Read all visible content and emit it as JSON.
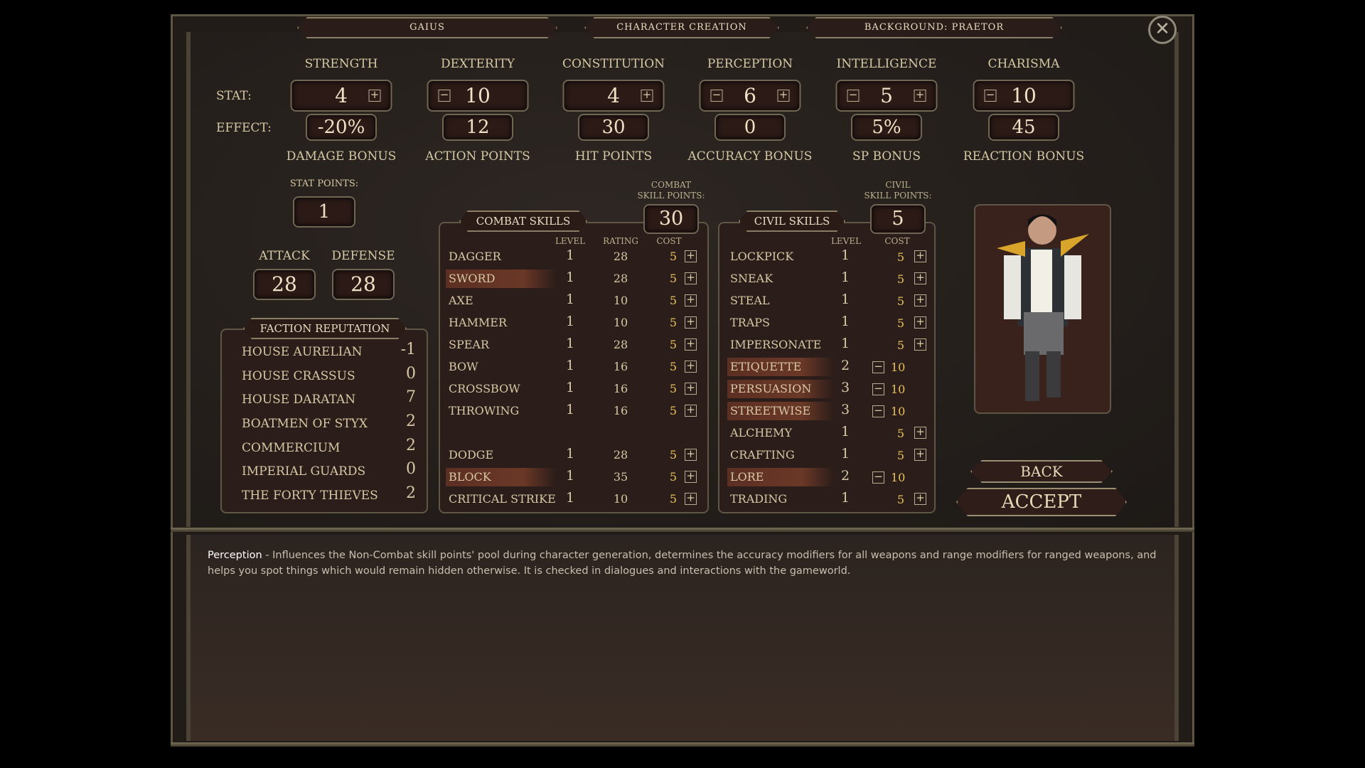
{
  "header": {
    "tabs": [
      "GAIUS",
      "CHARACTER CREATION",
      "BACKGROUND: PRAETOR"
    ],
    "close_icon": "close-x-icon"
  },
  "labels": {
    "stat": "STAT:",
    "effect": "EFFECT:",
    "stat_points": "STAT POINTS:",
    "attack": "ATTACK",
    "defense": "DEFENSE",
    "combat_points_l1": "COMBAT",
    "combat_points_l2": "SKILL POINTS:",
    "civil_points_l1": "CIVIL",
    "civil_points_l2": "SKILL POINTS:"
  },
  "stats": [
    {
      "name": "STRENGTH",
      "value": "4",
      "minus": false,
      "plus": true,
      "effect": "-20%",
      "bonus": "DAMAGE BONUS"
    },
    {
      "name": "DEXTERITY",
      "value": "10",
      "minus": true,
      "plus": false,
      "effect": "12",
      "bonus": "ACTION POINTS"
    },
    {
      "name": "CONSTITUTION",
      "value": "4",
      "minus": false,
      "plus": true,
      "effect": "30",
      "bonus": "HIT POINTS"
    },
    {
      "name": "PERCEPTION",
      "value": "6",
      "minus": true,
      "plus": true,
      "effect": "0",
      "bonus": "ACCURACY BONUS"
    },
    {
      "name": "INTELLIGENCE",
      "value": "5",
      "minus": true,
      "plus": true,
      "effect": "5%",
      "bonus": "SP BONUS"
    },
    {
      "name": "CHARISMA",
      "value": "10",
      "minus": true,
      "plus": false,
      "effect": "45",
      "bonus": "REACTION BONUS"
    }
  ],
  "stat_points": "1",
  "attack": "28",
  "defense": "28",
  "faction": {
    "title": "FACTION REPUTATION",
    "items": [
      {
        "name": "HOUSE AURELIAN",
        "value": "-1"
      },
      {
        "name": "HOUSE CRASSUS",
        "value": "0"
      },
      {
        "name": "HOUSE DARATAN",
        "value": "7"
      },
      {
        "name": "BOATMEN OF STYX",
        "value": "2"
      },
      {
        "name": "COMMERCIUM",
        "value": "2"
      },
      {
        "name": "IMPERIAL GUARDS",
        "value": "0"
      },
      {
        "name": "THE FORTY THIEVES",
        "value": "2"
      }
    ]
  },
  "combat": {
    "title": "COMBAT SKILLS",
    "points": "30",
    "headers": {
      "level": "LEVEL",
      "rating": "RATING",
      "cost": "COST"
    },
    "items": [
      {
        "name": "DAGGER",
        "level": "1",
        "rating": "28",
        "cost": "5",
        "hl": false
      },
      {
        "name": "SWORD",
        "level": "1",
        "rating": "28",
        "cost": "5",
        "hl": true
      },
      {
        "name": "AXE",
        "level": "1",
        "rating": "10",
        "cost": "5",
        "hl": false
      },
      {
        "name": "HAMMER",
        "level": "1",
        "rating": "10",
        "cost": "5",
        "hl": false
      },
      {
        "name": "SPEAR",
        "level": "1",
        "rating": "28",
        "cost": "5",
        "hl": false
      },
      {
        "name": "BOW",
        "level": "1",
        "rating": "16",
        "cost": "5",
        "hl": false
      },
      {
        "name": "CROSSBOW",
        "level": "1",
        "rating": "16",
        "cost": "5",
        "hl": false
      },
      {
        "name": "THROWING",
        "level": "1",
        "rating": "16",
        "cost": "5",
        "hl": false
      },
      {
        "name": "DODGE",
        "level": "1",
        "rating": "28",
        "cost": "5",
        "hl": false
      },
      {
        "name": "BLOCK",
        "level": "1",
        "rating": "35",
        "cost": "5",
        "hl": true
      },
      {
        "name": "CRITICAL STRIKE",
        "level": "1",
        "rating": "10",
        "cost": "5",
        "hl": false
      }
    ]
  },
  "civil": {
    "title": "CIVIL SKILLS",
    "points": "5",
    "headers": {
      "level": "LEVEL",
      "cost": "COST"
    },
    "items": [
      {
        "name": "LOCKPICK",
        "level": "1",
        "cost": "5",
        "hl": false
      },
      {
        "name": "SNEAK",
        "level": "1",
        "cost": "5",
        "hl": false
      },
      {
        "name": "STEAL",
        "level": "1",
        "cost": "5",
        "hl": false
      },
      {
        "name": "TRAPS",
        "level": "1",
        "cost": "5",
        "hl": false
      },
      {
        "name": "IMPERSONATE",
        "level": "1",
        "cost": "5",
        "hl": false
      },
      {
        "name": "ETIQUETTE",
        "level": "2",
        "cost": "10",
        "hl": true
      },
      {
        "name": "PERSUASION",
        "level": "3",
        "cost": "10",
        "hl": true
      },
      {
        "name": "STREETWISE",
        "level": "3",
        "cost": "10",
        "hl": true
      },
      {
        "name": "ALCHEMY",
        "level": "1",
        "cost": "5",
        "hl": false
      },
      {
        "name": "CRAFTING",
        "level": "1",
        "cost": "5",
        "hl": false
      },
      {
        "name": "LORE",
        "level": "2",
        "cost": "10",
        "hl": true
      },
      {
        "name": "TRADING",
        "level": "1",
        "cost": "5",
        "hl": false
      }
    ]
  },
  "buttons": {
    "back": "BACK",
    "accept": "ACCEPT"
  },
  "description": {
    "term": "Perception",
    "text": " - Influences the Non-Combat skill points' pool during character generation, determines the accuracy modifiers for all weapons and range modifiers for ranged weapons, and helps you spot things which would remain hidden otherwise. It is checked in dialogues and interactions with the gameworld."
  },
  "colors": {
    "text": "#d6c8a4",
    "cost": "#e8c15a",
    "highlight": "#6b3827",
    "background": "#221c19"
  }
}
